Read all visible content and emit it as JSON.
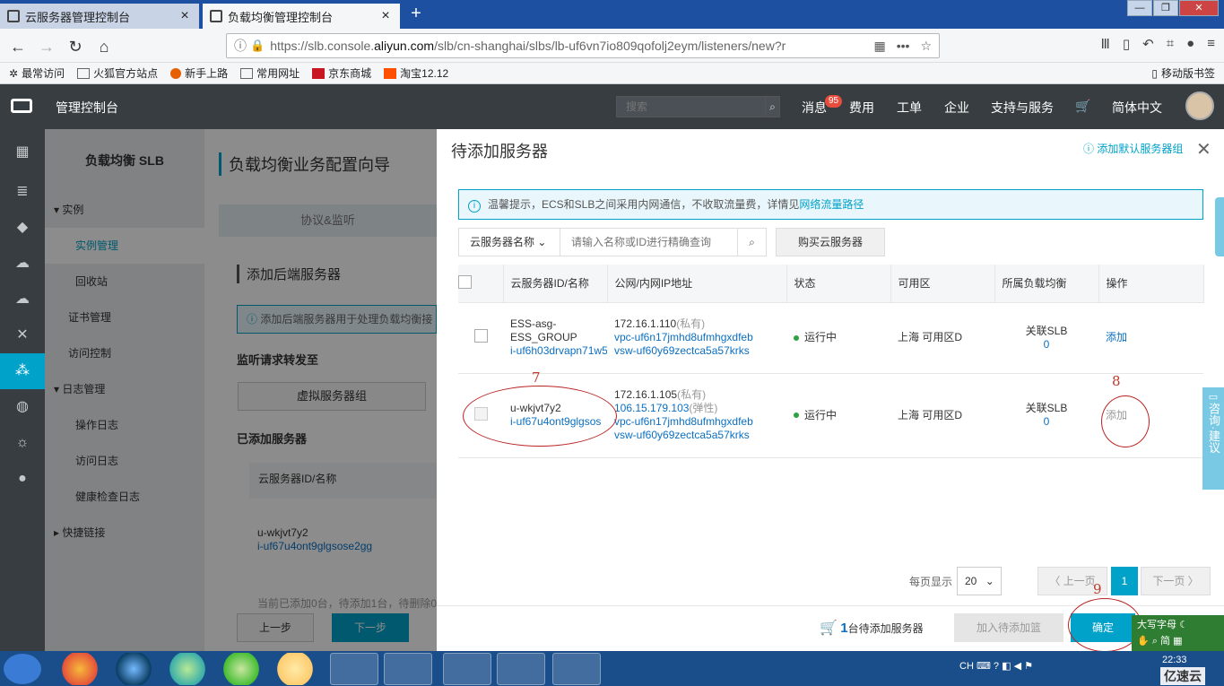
{
  "browser": {
    "tabs": [
      {
        "label": "云服务器管理控制台"
      },
      {
        "label": "负载均衡管理控制台"
      }
    ],
    "url_prefix": "https://slb.console.",
    "url_host": "aliyun.com",
    "url_rest": "/slb/cn-shanghai/slbs/lb-uf6vn7io809qofolj2eym/listeners/new?r",
    "bookmarks": [
      "最常访问",
      "火狐官方站点",
      "新手上路",
      "常用网址",
      "京东商城",
      "淘宝12.12"
    ],
    "mobile_bookmarks": "移动版书签"
  },
  "topbar": {
    "title": "管理控制台",
    "search_placeholder": "搜索",
    "nav": [
      "消息",
      "费用",
      "工单",
      "企业",
      "支持与服务",
      "简体中文"
    ],
    "message_badge": "95"
  },
  "sidebar": {
    "title": "负载均衡 SLB",
    "items": [
      "实例",
      "实例管理",
      "回收站",
      "证书管理",
      "访问控制",
      "日志管理",
      "操作日志",
      "访问日志",
      "健康检查日志",
      "快捷链接"
    ]
  },
  "wizard": {
    "title": "负载均衡业务配置向导",
    "step_tab": "协议&监听",
    "section_add": "添加后端服务器",
    "tip": "添加后端服务器用于处理负载均衡接",
    "forward_label": "监听请求转发至",
    "vgroup_btn": "虚拟服务器组",
    "added_label": "已添加服务器",
    "added_col": "云服务器ID/名称",
    "added_name": "u-wkjvt7y2",
    "added_id": "i-uf67u4ont9glgsose2gg",
    "added_status": "当前已添加0台，待添加1台，待删除0",
    "prev_btn": "上一步",
    "next_btn": "下一步"
  },
  "drawer": {
    "title": "待添加服务器",
    "help_link": "添加默认服务器组",
    "tip_text": "温馨提示，ECS和SLB之间采用内网通信，不收取流量费，详情见",
    "tip_link": "网络流量路径",
    "filter_select": "云服务器名称",
    "filter_placeholder": "请输入名称或ID进行精确查询",
    "buy_btn": "购买云服务器",
    "columns": [
      "云服务器ID/名称",
      "公网/内网IP地址",
      "状态",
      "可用区",
      "所属负载均衡",
      "操作"
    ],
    "rows": [
      {
        "name1": "ESS-asg-",
        "name2": "ESS_GROUP",
        "id": "i-uf6h03drvapn71w5",
        "ip": "172.16.1.110",
        "ip_tag": "(私有)",
        "vpc": "vpc-uf6n17jmhd8ufmhgxdfeb",
        "vsw": "vsw-uf60y69zectca5a57krks",
        "status": "运行中",
        "zone": "上海 可用区D",
        "slb_label": "关联SLB",
        "slb_count": "0",
        "action": "添加"
      },
      {
        "name1": "u-wkjvt7y2",
        "id": "i-uf67u4ont9glgsos",
        "ip": "172.16.1.105",
        "ip_tag": "(私有)",
        "public_ip": "106.15.179.103",
        "public_tag": "(弹性)",
        "vpc": "vpc-uf6n17jmhd8ufmhgxdfeb",
        "vsw": "vsw-uf60y69zectca5a57krks",
        "status": "运行中",
        "zone": "上海 可用区D",
        "slb_label": "关联SLB",
        "slb_count": "0",
        "action": "添加"
      }
    ],
    "pager_label": "每页显示",
    "page_size": "20",
    "prev_page": "上一页",
    "current_page": "1",
    "next_page": "下一页",
    "cart_count": "1",
    "cart_label": "台待添加服务器",
    "add_queue_btn": "加入待添加篮",
    "confirm_btn": "确定"
  },
  "annotations": [
    "7",
    "8",
    "9"
  ],
  "side_help": "咨询·建议",
  "ime": {
    "line1": "大写字母",
    "line2": "简"
  },
  "taskbar": {
    "tray_lang": "CH",
    "clock": "22:33",
    "watermark": "亿速云"
  }
}
